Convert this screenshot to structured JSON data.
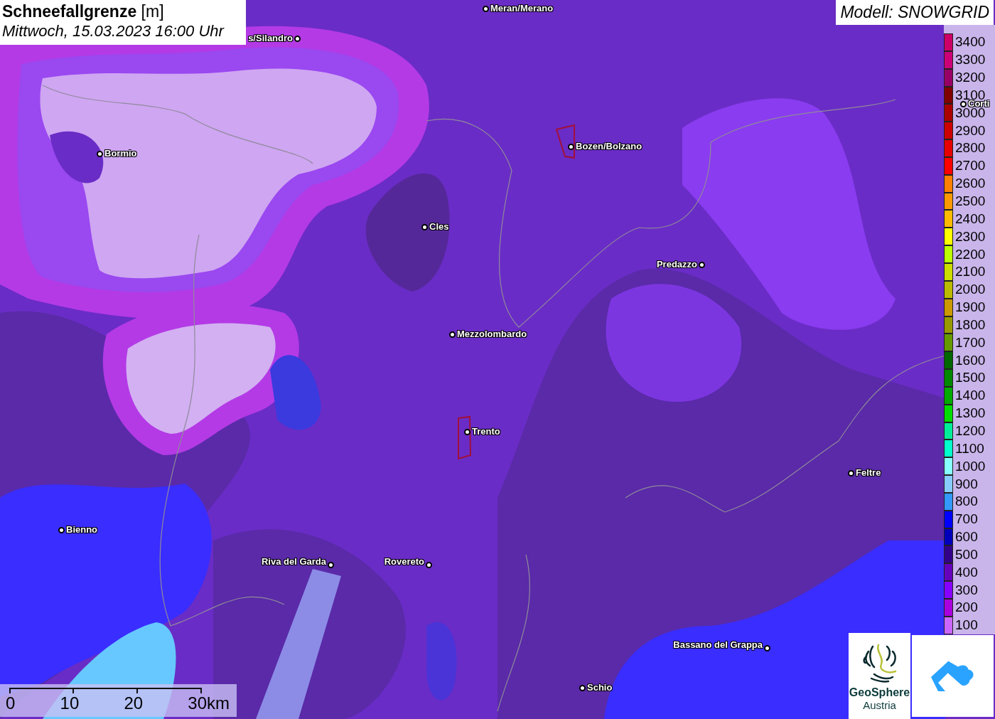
{
  "title": {
    "heading": "**Schneefallgrenze** [m]",
    "datetime": "Mittwoch, 15.03.2023 16:00 Uhr"
  },
  "model_label": "Modell: SNOWGRID",
  "places": [
    {
      "name": "Meran/Merano"
    },
    {
      "name": "s/Silandro"
    },
    {
      "name": "Bormio"
    },
    {
      "name": "Bozen/Bolzano"
    },
    {
      "name": "Cles"
    },
    {
      "name": "Predazzo"
    },
    {
      "name": "Mezzolombardo"
    },
    {
      "name": "Trento"
    },
    {
      "name": "Feltre"
    },
    {
      "name": "Bienno"
    },
    {
      "name": "Riva del Garda"
    },
    {
      "name": "Rovereto"
    },
    {
      "name": "Bassano del Grappa"
    },
    {
      "name": "Schio"
    },
    {
      "name": "Corti"
    }
  ],
  "legend": [
    {
      "label": "3400",
      "color": "#cc0066"
    },
    {
      "label": "3300",
      "color": "#cc0077"
    },
    {
      "label": "3200",
      "color": "#990066"
    },
    {
      "label": "3100",
      "color": "#800000"
    },
    {
      "label": "3000",
      "color": "#aa0000"
    },
    {
      "label": "2900",
      "color": "#cc0000"
    },
    {
      "label": "2800",
      "color": "#e60000"
    },
    {
      "label": "2700",
      "color": "#ff0000"
    },
    {
      "label": "2600",
      "color": "#ff8000"
    },
    {
      "label": "2500",
      "color": "#ff9900"
    },
    {
      "label": "2400",
      "color": "#ffbb00"
    },
    {
      "label": "2300",
      "color": "#ffff00"
    },
    {
      "label": "2200",
      "color": "#bbff00"
    },
    {
      "label": "2100",
      "color": "#ccdd00"
    },
    {
      "label": "2000",
      "color": "#bbbb00"
    },
    {
      "label": "1900",
      "color": "#cc9900"
    },
    {
      "label": "1800",
      "color": "#999900"
    },
    {
      "label": "1700",
      "color": "#669900"
    },
    {
      "label": "1600",
      "color": "#006600"
    },
    {
      "label": "1500",
      "color": "#008800"
    },
    {
      "label": "1400",
      "color": "#00aa00"
    },
    {
      "label": "1300",
      "color": "#00dd00"
    },
    {
      "label": "1200",
      "color": "#00ee99"
    },
    {
      "label": "1100",
      "color": "#00ffcc"
    },
    {
      "label": "1000",
      "color": "#88ffff"
    },
    {
      "label": "900",
      "color": "#88ccff"
    },
    {
      "label": "800",
      "color": "#3399ff"
    },
    {
      "label": "700",
      "color": "#0000ff"
    },
    {
      "label": "600",
      "color": "#0000bb"
    },
    {
      "label": "500",
      "color": "#330088"
    },
    {
      "label": "400",
      "color": "#6600bb"
    },
    {
      "label": "300",
      "color": "#8800ff"
    },
    {
      "label": "200",
      "color": "#aa00dd"
    },
    {
      "label": "100",
      "color": "#cc66ff"
    }
  ],
  "scale_bar": [
    "0",
    "10",
    "20",
    "30km"
  ],
  "logo": {
    "name": "GeoSphere",
    "sub": "Austria"
  }
}
